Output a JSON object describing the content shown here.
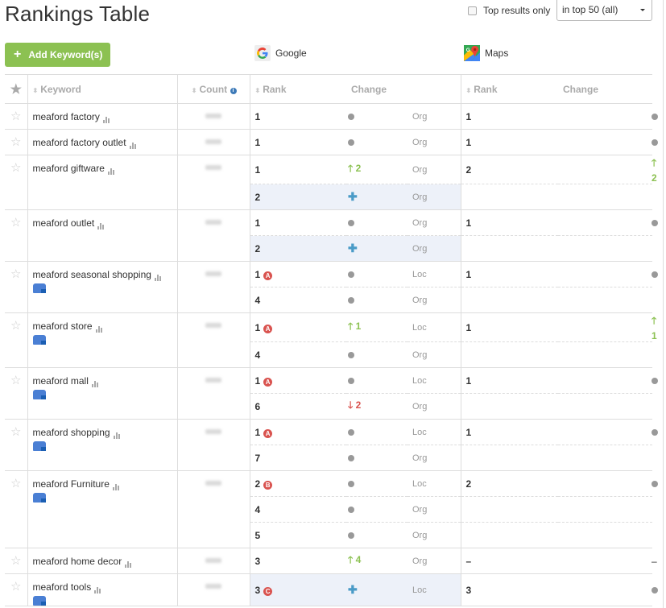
{
  "page": {
    "title": "Rankings Table",
    "top_results_label": "Top results only",
    "top_results_checked": false,
    "range_select": "in top 50 (all)",
    "add_keyword_label": "Add Keyword(s)"
  },
  "engines": {
    "google": {
      "label": "Google",
      "icon": "google-g-icon"
    },
    "maps": {
      "label": "Maps",
      "icon": "google-maps-icon"
    }
  },
  "colors": {
    "accent_green": "#8cc152",
    "up": "#8cc152",
    "down": "#d9534f",
    "new": "#4a9bc7",
    "pack_badge": "#d9534f",
    "highlight_row": "#edf1f9"
  },
  "headers": {
    "keyword": "Keyword",
    "count": "Count",
    "google_rank": "Rank",
    "google_change": "Change",
    "maps_rank": "Rank",
    "maps_change": "Change"
  },
  "rows": [
    {
      "keyword": "meaford factory",
      "gmb": false,
      "google": [
        {
          "rank": "1",
          "pack": "",
          "change": {
            "type": "none",
            "value": ""
          },
          "kind": "Org",
          "highlight": false
        }
      ],
      "maps": {
        "rank": "1",
        "change": {
          "type": "none",
          "value": ""
        }
      }
    },
    {
      "keyword": "meaford factory outlet",
      "gmb": false,
      "google": [
        {
          "rank": "1",
          "pack": "",
          "change": {
            "type": "none",
            "value": ""
          },
          "kind": "Org",
          "highlight": false
        }
      ],
      "maps": {
        "rank": "1",
        "change": {
          "type": "none",
          "value": ""
        }
      }
    },
    {
      "keyword": "meaford giftware",
      "gmb": false,
      "google": [
        {
          "rank": "1",
          "pack": "",
          "change": {
            "type": "up",
            "value": "2"
          },
          "kind": "Org",
          "highlight": false
        },
        {
          "rank": "2",
          "pack": "",
          "change": {
            "type": "new",
            "value": ""
          },
          "kind": "Org",
          "highlight": true
        }
      ],
      "maps": {
        "rank": "2",
        "change": {
          "type": "up",
          "value": "2"
        }
      }
    },
    {
      "keyword": "meaford outlet",
      "gmb": false,
      "google": [
        {
          "rank": "1",
          "pack": "",
          "change": {
            "type": "none",
            "value": ""
          },
          "kind": "Org",
          "highlight": false
        },
        {
          "rank": "2",
          "pack": "",
          "change": {
            "type": "new",
            "value": ""
          },
          "kind": "Org",
          "highlight": true
        }
      ],
      "maps": {
        "rank": "1",
        "change": {
          "type": "none",
          "value": ""
        }
      }
    },
    {
      "keyword": "meaford seasonal shopping",
      "gmb": true,
      "google": [
        {
          "rank": "1",
          "pack": "A",
          "change": {
            "type": "none",
            "value": ""
          },
          "kind": "Loc",
          "highlight": false
        },
        {
          "rank": "4",
          "pack": "",
          "change": {
            "type": "none",
            "value": ""
          },
          "kind": "Org",
          "highlight": false
        }
      ],
      "maps": {
        "rank": "1",
        "change": {
          "type": "none",
          "value": ""
        }
      }
    },
    {
      "keyword": "meaford store",
      "gmb": true,
      "google": [
        {
          "rank": "1",
          "pack": "A",
          "change": {
            "type": "up",
            "value": "1"
          },
          "kind": "Loc",
          "highlight": false
        },
        {
          "rank": "4",
          "pack": "",
          "change": {
            "type": "none",
            "value": ""
          },
          "kind": "Org",
          "highlight": false
        }
      ],
      "maps": {
        "rank": "1",
        "change": {
          "type": "up",
          "value": "1"
        }
      }
    },
    {
      "keyword": "meaford mall",
      "gmb": true,
      "google": [
        {
          "rank": "1",
          "pack": "A",
          "change": {
            "type": "none",
            "value": ""
          },
          "kind": "Loc",
          "highlight": false
        },
        {
          "rank": "6",
          "pack": "",
          "change": {
            "type": "down",
            "value": "2"
          },
          "kind": "Org",
          "highlight": false
        }
      ],
      "maps": {
        "rank": "1",
        "change": {
          "type": "none",
          "value": ""
        }
      }
    },
    {
      "keyword": "meaford shopping",
      "gmb": true,
      "google": [
        {
          "rank": "1",
          "pack": "A",
          "change": {
            "type": "none",
            "value": ""
          },
          "kind": "Loc",
          "highlight": false
        },
        {
          "rank": "7",
          "pack": "",
          "change": {
            "type": "none",
            "value": ""
          },
          "kind": "Org",
          "highlight": false
        }
      ],
      "maps": {
        "rank": "1",
        "change": {
          "type": "none",
          "value": ""
        }
      }
    },
    {
      "keyword": "meaford Furniture",
      "gmb": true,
      "google": [
        {
          "rank": "2",
          "pack": "B",
          "change": {
            "type": "none",
            "value": ""
          },
          "kind": "Loc",
          "highlight": false
        },
        {
          "rank": "4",
          "pack": "",
          "change": {
            "type": "none",
            "value": ""
          },
          "kind": "Org",
          "highlight": false
        },
        {
          "rank": "5",
          "pack": "",
          "change": {
            "type": "none",
            "value": ""
          },
          "kind": "Org",
          "highlight": false
        }
      ],
      "maps": {
        "rank": "2",
        "change": {
          "type": "none",
          "value": ""
        }
      }
    },
    {
      "keyword": "meaford home decor",
      "gmb": false,
      "google": [
        {
          "rank": "3",
          "pack": "",
          "change": {
            "type": "up",
            "value": "4"
          },
          "kind": "Org",
          "highlight": false
        }
      ],
      "maps": {
        "rank": "–",
        "change": {
          "type": "dash",
          "value": "–"
        }
      }
    },
    {
      "keyword": "meaford tools",
      "gmb": true,
      "google": [
        {
          "rank": "3",
          "pack": "C",
          "change": {
            "type": "new",
            "value": ""
          },
          "kind": "Loc",
          "highlight": true
        }
      ],
      "maps": {
        "rank": "3",
        "change": {
          "type": "none",
          "value": ""
        }
      }
    }
  ]
}
